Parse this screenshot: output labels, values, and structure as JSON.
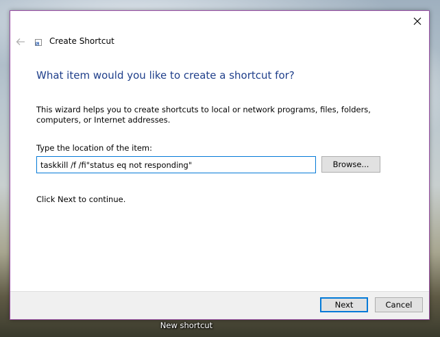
{
  "dialog": {
    "title": "Create Shortcut",
    "heading": "What item would you like to create a shortcut for?",
    "description": "This wizard helps you to create shortcuts to local or network programs, files, folders, computers, or Internet addresses.",
    "location_label": "Type the location of the item:",
    "location_value": "taskkill /f /fi\"status eq not responding\"",
    "browse_label": "Browse...",
    "continue_text": "Click Next to continue.",
    "next_label": "Next",
    "cancel_label": "Cancel"
  },
  "desktop": {
    "icon_label": "New shortcut"
  },
  "icons": {
    "close": "close-icon",
    "back": "back-arrow-icon",
    "title": "shortcut-icon"
  },
  "colors": {
    "heading": "#1e3e8a",
    "accent": "#0078d7",
    "window_border": "#9b4fa6"
  }
}
